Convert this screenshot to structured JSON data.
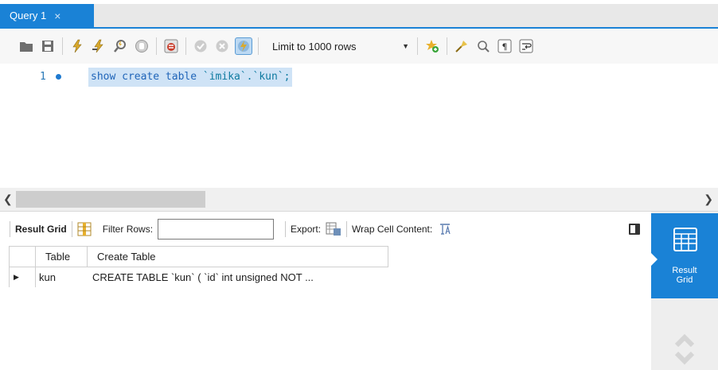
{
  "tab": {
    "title": "Query 1",
    "close_glyph": "×"
  },
  "toolbar": {
    "icons": [
      "open-folder-icon",
      "save-icon",
      "execute-icon",
      "execute-current-icon",
      "explain-icon",
      "stop-icon",
      "toggle-continue-on-error-icon",
      "commit-icon",
      "rollback-icon",
      "autocommit-icon"
    ],
    "limit_select": {
      "value": "Limit to 1000 rows"
    },
    "right_icons": [
      "add-snippet-icon",
      "beautify-icon",
      "find-icon",
      "invisible-chars-icon",
      "wrap-lines-icon"
    ]
  },
  "editor": {
    "line_number": "1",
    "code": {
      "kw1": "show create table",
      "space": " ",
      "txt": "`imika`.`kun`;"
    }
  },
  "result_toolbar": {
    "result_grid_label": "Result Grid",
    "filter_rows_label": "Filter Rows:",
    "filter_value": "",
    "export_label": "Export:",
    "wrap_label": "Wrap Cell Content:"
  },
  "grid": {
    "columns": [
      "Table",
      "Create Table"
    ],
    "rows": [
      {
        "table": "kun",
        "create": "CREATE TABLE `kun` (  `id` int unsigned NOT ..."
      }
    ]
  },
  "side_panel": {
    "active_label_1": "Result",
    "active_label_2": "Grid"
  },
  "colors": {
    "accent": "#1a82d6",
    "selection": "#cfe3f6",
    "keyword": "#1f64b8"
  }
}
